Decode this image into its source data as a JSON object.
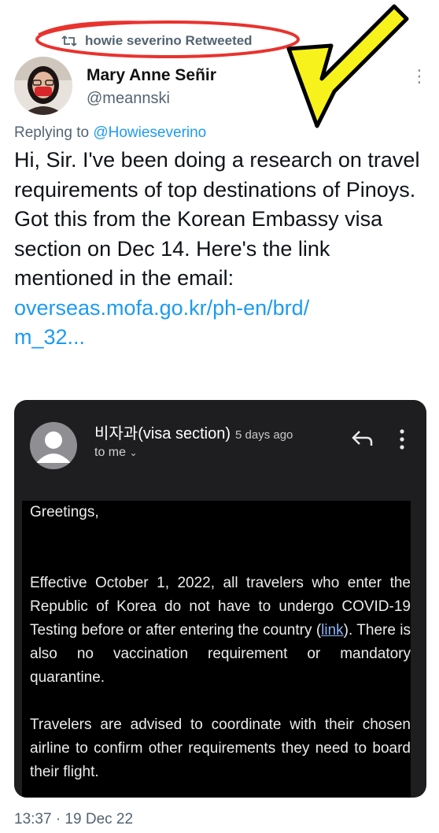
{
  "retweet": {
    "label": "howie severino Retweeted"
  },
  "author": {
    "name": "Mary Anne Señir",
    "handle": "@meannski"
  },
  "reply": {
    "prefix": "Replying to ",
    "mention": "@Howieseverino"
  },
  "tweet": {
    "text": "Hi, Sir. I've been doing a research on travel requirements of top destinations of Pinoys. Got this from the Korean Embassy visa section on Dec 14. Here's the link mentioned in the email:",
    "link_line1": "overseas.mofa.go.kr/ph-en/brd/",
    "link_line2": "m_32..."
  },
  "email": {
    "sender": "비자과(visa section)",
    "time": "5 days ago",
    "to": "to me",
    "greeting": "Greetings,",
    "p1_before": "Effective October 1, 2022, all travelers who enter the Republic of Korea do not have to undergo COVID-19 Testing before or after entering the country (",
    "p1_link": "link",
    "p1_after": "). There is also no vaccination requirement or mandatory quarantine.",
    "p2": "Travelers are advised to coordinate with their chosen airline to confirm other requirements they need to board their flight."
  },
  "timestamp": "13:37 · 19 Dec 22",
  "colors": {
    "link": "#1d9bf0",
    "annotation_red": "#e8332e",
    "arrow_yellow": "#f7f21b"
  },
  "icons": [
    "retweet-icon",
    "more-options-icon",
    "reply-icon",
    "email-menu-icon",
    "chevron-down-icon"
  ]
}
